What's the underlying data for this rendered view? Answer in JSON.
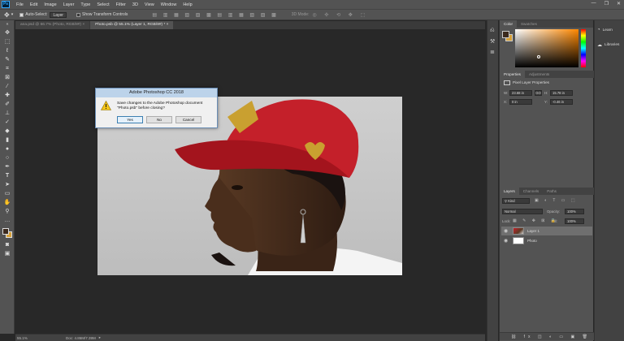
{
  "menubar": {
    "logo": "Ps",
    "items": [
      "File",
      "Edit",
      "Image",
      "Layer",
      "Type",
      "Select",
      "Filter",
      "3D",
      "View",
      "Window",
      "Help"
    ],
    "window_controls": [
      "—",
      "❐",
      "✕"
    ]
  },
  "options_bar": {
    "auto_select_label": "Auto-Select:",
    "auto_select_value": "Layer",
    "transform_label": "Show Transform Controls",
    "mode_3d_label": "3D Mode:"
  },
  "doc_tabs": [
    {
      "label": "ana.psd @ 66.7% (Photo, RGB/8#) ×"
    },
    {
      "label": "Photo.psb @ 55.1% (Layer 1, RGB/8#) * ×"
    }
  ],
  "dialog": {
    "title": "Adobe Photoshop CC 2018",
    "message": "Save changes to the Adobe Photoshop document \"Photo.psb\" before closing?",
    "yes": "Yes",
    "no": "No",
    "cancel": "Cancel",
    "icon": "warning-icon"
  },
  "status": {
    "zoom": "55.1%",
    "doc": "Doc: 4.86M/7.39M"
  },
  "color_panel": {
    "tabs": [
      "Color",
      "Swatches"
    ],
    "foreground": "#3b2a1e",
    "hue": "#ff8800"
  },
  "properties_panel": {
    "tabs": [
      "Properties",
      "Adjustments"
    ],
    "heading": "Pixel Layer Properties",
    "w_label": "W:",
    "w_value": "23.68 in",
    "go_label": "GO",
    "h_label": "H:",
    "h_value": "15.78 in",
    "x_label": "X:",
    "x_value": "0 in",
    "y_label": "Y:",
    "y_value": "-0.46 in"
  },
  "layers_panel": {
    "tabs": [
      "Layers",
      "Channels",
      "Paths"
    ],
    "kind_label": "Kind",
    "blend_mode": "Normal",
    "opacity_label": "Opacity:",
    "opacity_value": "100%",
    "lock_label": "Lock:",
    "fill_label": "Fill:",
    "fill_value": "100%",
    "layers": [
      {
        "name": "Layer 1",
        "selected": true
      },
      {
        "name": "Photo",
        "selected": false
      }
    ]
  },
  "libraries": {
    "learn": "Learn",
    "libraries": "Libraries"
  }
}
